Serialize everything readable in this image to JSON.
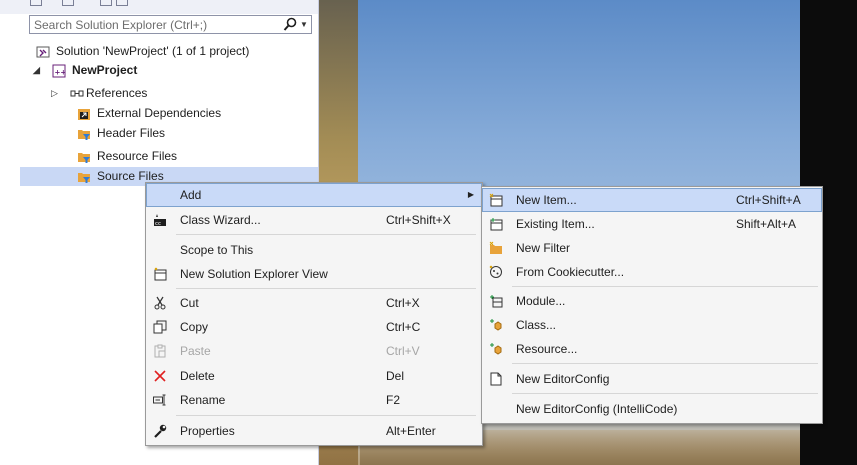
{
  "solution_explorer": {
    "search_placeholder": "Search Solution Explorer (Ctrl+;)",
    "tree": [
      {
        "label": "Solution 'NewProject'  (1 of 1 project)",
        "icon": "solution-icon"
      },
      {
        "label": "NewProject",
        "icon": "cpp-project-icon",
        "bold": true,
        "expanded": true
      },
      {
        "label": "References",
        "icon": "references-icon",
        "collapsed": true
      },
      {
        "label": "External Dependencies",
        "icon": "external-dependencies-icon"
      },
      {
        "label": "Header Files",
        "icon": "filter-folder-icon"
      },
      {
        "label": "Resource Files",
        "icon": "filter-folder-icon"
      },
      {
        "label": "Source Files",
        "icon": "filter-folder-icon",
        "selected": true
      }
    ]
  },
  "context_menu": {
    "items": [
      {
        "label": "Add",
        "shortcut": "",
        "icon": "",
        "submenu": true,
        "highlighted": true
      },
      {
        "label": "Class Wizard...",
        "shortcut": "Ctrl+Shift+X",
        "icon": "class-wizard-icon"
      },
      {
        "label": "Scope to This",
        "shortcut": "",
        "icon": ""
      },
      {
        "label": "New Solution Explorer View",
        "shortcut": "",
        "icon": "new-view-icon"
      },
      {
        "label": "Cut",
        "shortcut": "Ctrl+X",
        "icon": "cut-icon"
      },
      {
        "label": "Copy",
        "shortcut": "Ctrl+C",
        "icon": "copy-icon"
      },
      {
        "label": "Paste",
        "shortcut": "Ctrl+V",
        "icon": "paste-icon",
        "disabled": true
      },
      {
        "label": "Delete",
        "shortcut": "Del",
        "icon": "delete-icon"
      },
      {
        "label": "Rename",
        "shortcut": "F2",
        "icon": "rename-icon"
      },
      {
        "label": "Properties",
        "shortcut": "Alt+Enter",
        "icon": "properties-icon"
      }
    ]
  },
  "add_submenu": {
    "items": [
      {
        "label": "New Item...",
        "shortcut": "Ctrl+Shift+A",
        "icon": "new-item-icon",
        "highlighted": true
      },
      {
        "label": "Existing Item...",
        "shortcut": "Shift+Alt+A",
        "icon": "existing-item-icon"
      },
      {
        "label": "New Filter",
        "shortcut": "",
        "icon": "new-filter-icon"
      },
      {
        "label": "From Cookiecutter...",
        "shortcut": "",
        "icon": "cookiecutter-icon"
      },
      {
        "label": "Module...",
        "shortcut": "",
        "icon": "module-icon"
      },
      {
        "label": "Class...",
        "shortcut": "",
        "icon": "class-icon"
      },
      {
        "label": "Resource...",
        "shortcut": "",
        "icon": "resource-icon"
      },
      {
        "label": "New EditorConfig",
        "shortcut": "",
        "icon": "editorconfig-icon"
      },
      {
        "label": "New EditorConfig (IntelliCode)",
        "shortcut": "",
        "icon": ""
      }
    ]
  },
  "colors": {
    "selection": "#c9d8f5",
    "menu_highlight": "#c9daf8",
    "menu_background": "#f5f5f5",
    "delete_red": "#e02020",
    "folder_orange": "#e8a33a"
  }
}
